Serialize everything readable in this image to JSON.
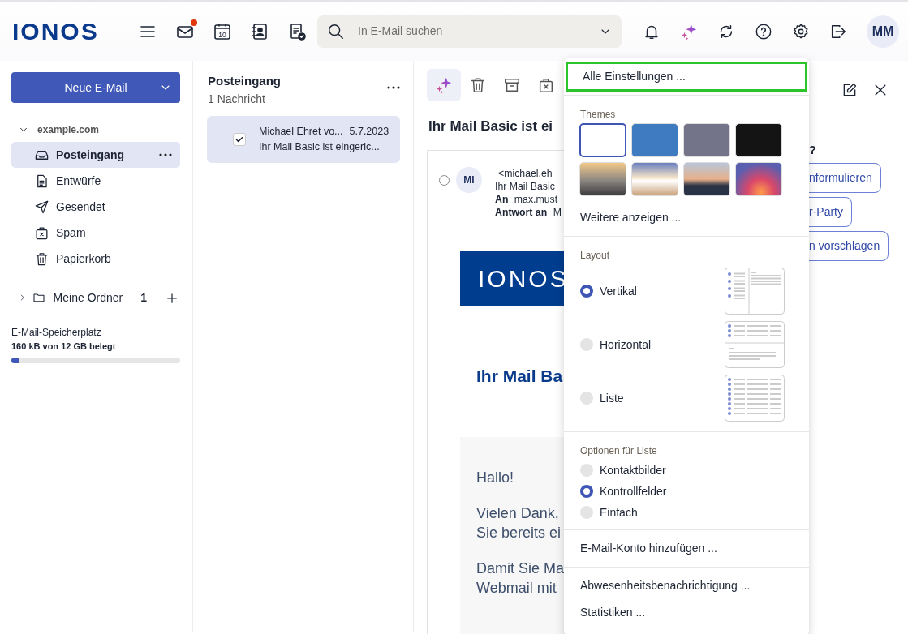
{
  "header": {
    "logo": "IONOS",
    "mail_unread": true,
    "calendar_day": "10",
    "search": {
      "placeholder": "In E-Mail suchen"
    },
    "avatar": "MM"
  },
  "sidebar": {
    "new_button": "Neue E-Mail",
    "account": {
      "label": "example.com",
      "expanded": true
    },
    "folders": [
      {
        "kind": "inbox",
        "label": "Posteingang",
        "selected": true
      },
      {
        "kind": "drafts",
        "label": "Entwürfe",
        "selected": false
      },
      {
        "kind": "sent",
        "label": "Gesendet",
        "selected": false
      },
      {
        "kind": "spam",
        "label": "Spam",
        "selected": false
      },
      {
        "kind": "trash",
        "label": "Papierkorb",
        "selected": false
      }
    ],
    "my_folders": {
      "label": "Meine Ordner",
      "count": "1",
      "expanded": false
    },
    "storage": {
      "label": "E-Mail-Speicherplatz",
      "usage": "160 kB von 12 GB belegt",
      "level": 0.05
    }
  },
  "message_list": {
    "title": "Posteingang",
    "count": "1 Nachricht",
    "messages": [
      {
        "sender": "Michael Ehret vo...",
        "date": "5.7.2023",
        "subject": "Ihr Mail Basic ist eingeric...",
        "selected": true,
        "checked": true
      }
    ]
  },
  "reading_pane": {
    "subject": "Ihr Mail Basic ist ei",
    "selected": false,
    "avatar": "MI",
    "sender_address": "<michael.eh",
    "preview": "Ihr Mail Basic",
    "to_label": "An",
    "to": "max.must",
    "reply_label": "Antwort an",
    "reply_to": "M",
    "banner": "IONOS",
    "heading": "Ihr Mail Ba",
    "paragraphs": [
      [
        "Hallo!"
      ],
      [
        "Vielen Dank,",
        "Sie bereits ei"
      ],
      [
        "Damit Sie Ma",
        "Webmail mit"
      ]
    ]
  },
  "assistant": {
    "question": "?",
    "suggestions": [
      "nformulieren",
      "r-Party",
      "n vorschlagen"
    ]
  },
  "settings_menu": {
    "top_item": {
      "label": "Alle Einstellungen ...",
      "highlighted": true
    },
    "themes": {
      "label": "Themes",
      "swatches": [
        {
          "kind": "color",
          "color": "#ffffff",
          "selected": true
        },
        {
          "kind": "color",
          "color": "#3f7bc1",
          "selected": false
        },
        {
          "kind": "color",
          "color": "#737489",
          "selected": false
        },
        {
          "kind": "color",
          "color": "#141414",
          "selected": false
        },
        {
          "kind": "photo",
          "selected": false
        },
        {
          "kind": "photo",
          "selected": false
        },
        {
          "kind": "photo",
          "selected": false
        },
        {
          "kind": "photo",
          "selected": false
        }
      ],
      "more": "Weitere anzeigen ..."
    },
    "layout": {
      "label": "Layout",
      "options": [
        {
          "kind": "vertical",
          "label": "Vertikal",
          "selected": true
        },
        {
          "kind": "horizontal",
          "label": "Horizontal",
          "selected": false
        },
        {
          "kind": "list",
          "label": "Liste",
          "selected": false
        }
      ]
    },
    "list_options": {
      "label": "Optionen für Liste",
      "options": [
        {
          "label": "Kontaktbilder",
          "selected": false
        },
        {
          "label": "Kontrollfelder",
          "selected": true
        },
        {
          "label": "Einfach",
          "selected": false
        }
      ]
    },
    "account_items": [
      "E-Mail-Konto hinzufügen ..."
    ],
    "extra_items": [
      "Abwesenheitsbenachrichtigung ...",
      "Statistiken ..."
    ]
  }
}
